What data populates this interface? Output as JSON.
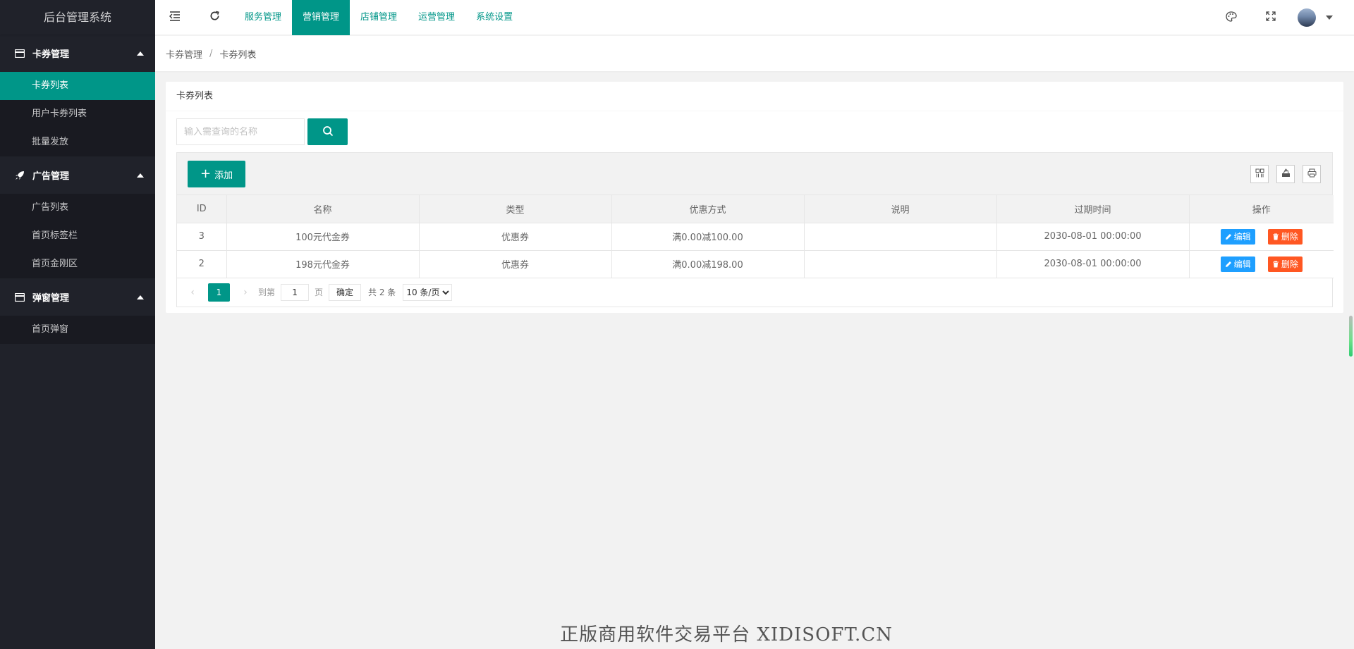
{
  "app": {
    "title": "后台管理系统"
  },
  "sidebar": {
    "groups": [
      {
        "title": "卡券管理",
        "icon": "card-icon",
        "items": [
          "卡券列表",
          "用户卡券列表",
          "批量发放"
        ],
        "active_index": 0
      },
      {
        "title": "广告管理",
        "icon": "rocket-icon",
        "items": [
          "广告列表",
          "首页标签栏",
          "首页金刚区"
        ]
      },
      {
        "title": "弹窗管理",
        "icon": "card-icon",
        "items": [
          "首页弹窗"
        ]
      }
    ]
  },
  "header": {
    "tabs": [
      "服务管理",
      "营销管理",
      "店铺管理",
      "运营管理",
      "系统设置"
    ],
    "active_tab": "营销管理",
    "icons": [
      "shrink-menu-icon",
      "refresh-icon",
      "theme-palette-icon",
      "fullscreen-icon",
      "avatar",
      "chevron-down-icon"
    ]
  },
  "breadcrumb": {
    "parent": "卡券管理",
    "separator": "/",
    "current": "卡券列表"
  },
  "card": {
    "title": "卡券列表",
    "search": {
      "placeholder": "输入需查询的名称",
      "value": ""
    },
    "toolbar": {
      "add_label": "添加",
      "icons": [
        "columns-filter-icon",
        "export-icon",
        "print-icon"
      ]
    },
    "table": {
      "columns": [
        "ID",
        "名称",
        "类型",
        "优惠方式",
        "说明",
        "过期时间",
        "操作"
      ],
      "rows": [
        {
          "id": "3",
          "name": "100元代金券",
          "type": "优惠券",
          "discount": "满0.00减100.00",
          "desc": "",
          "expire": "2030-08-01 00:00:00"
        },
        {
          "id": "2",
          "name": "198元代金券",
          "type": "优惠券",
          "discount": "满0.00减198.00",
          "desc": "",
          "expire": "2030-08-01 00:00:00"
        }
      ],
      "edit_label": "编辑",
      "delete_label": "删除"
    },
    "pager": {
      "current_page": "1",
      "goto_label": "到第",
      "goto_value": "1",
      "page_label": "页",
      "confirm_label": "确定",
      "total_label": "共 2 条",
      "page_size": "10 条/页"
    }
  },
  "colors": {
    "primary": "#009688",
    "sidebar_bg": "#20222a",
    "edit": "#1e9fff",
    "delete": "#ff5722"
  },
  "watermark": "正版商用软件交易平台 XIDISOFT.CN"
}
